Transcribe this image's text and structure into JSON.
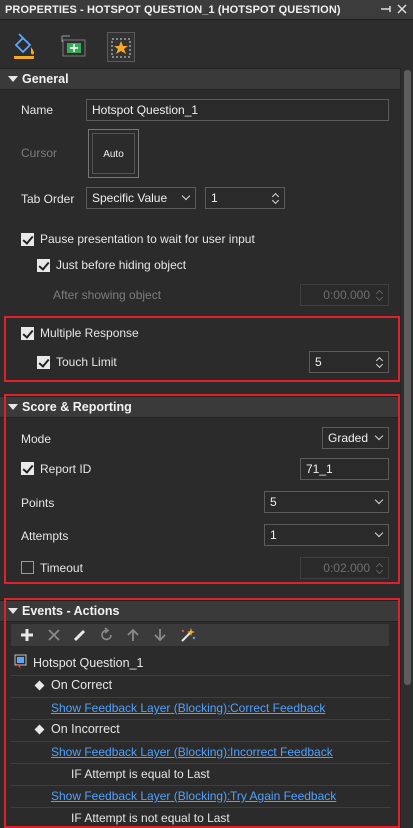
{
  "window": {
    "title": "PROPERTIES - HOTSPOT QUESTION_1 (HOTSPOT QUESTION)"
  },
  "tabs": [
    {
      "icon": "paint-bucket-icon",
      "active": false
    },
    {
      "icon": "size-position-icon",
      "active": false
    },
    {
      "icon": "interactivity-star-icon",
      "active": true
    }
  ],
  "general": {
    "header": "General",
    "name_label": "Name",
    "name_value": "Hotspot Question_1",
    "cursor_label": "Cursor",
    "cursor_value": "Auto",
    "tab_order_label": "Tab Order",
    "tab_order_mode": "Specific Value",
    "tab_order_value": "1",
    "pause_label": "Pause presentation to wait for user input",
    "pause_checked": true,
    "before_hiding_label": "Just before hiding object",
    "before_hiding_checked": true,
    "after_showing_label": "After showing object",
    "after_showing_value": "0:00.000",
    "multiple_response_label": "Multiple Response",
    "multiple_response_checked": true,
    "touch_limit_label": "Touch Limit",
    "touch_limit_checked": true,
    "touch_limit_value": "5"
  },
  "score": {
    "header": "Score & Reporting",
    "mode_label": "Mode",
    "mode_value": "Graded",
    "report_id_label": "Report ID",
    "report_id_checked": true,
    "report_id_value": "71_1",
    "points_label": "Points",
    "points_value": "5",
    "attempts_label": "Attempts",
    "attempts_value": "1",
    "timeout_label": "Timeout",
    "timeout_checked": false,
    "timeout_value": "0:02.000"
  },
  "events": {
    "header": "Events - Actions",
    "toolbar": [
      "add-icon",
      "delete-icon",
      "edit-icon",
      "refresh-icon",
      "move-up-icon",
      "move-down-icon",
      "magic-wand-icon"
    ],
    "root": "Hotspot Question_1",
    "on_correct": "On Correct",
    "correct_action": "Show Feedback Layer (Blocking):",
    "correct_target": "Correct Feedback",
    "on_incorrect": "On Incorrect",
    "incorrect_action": "Show Feedback Layer (Blocking):",
    "incorrect_target": "Incorrect Feedback",
    "incorrect_condition": "IF Attempt is equal to Last",
    "tryagain_action": "Show Feedback Layer (Blocking):",
    "tryagain_target": "Try Again Feedback",
    "tryagain_condition": "IF Attempt is not equal to Last"
  },
  "colors": {
    "highlight": "#e0202a",
    "link": "#4ea1ff",
    "panel": "#2b2b2b"
  }
}
